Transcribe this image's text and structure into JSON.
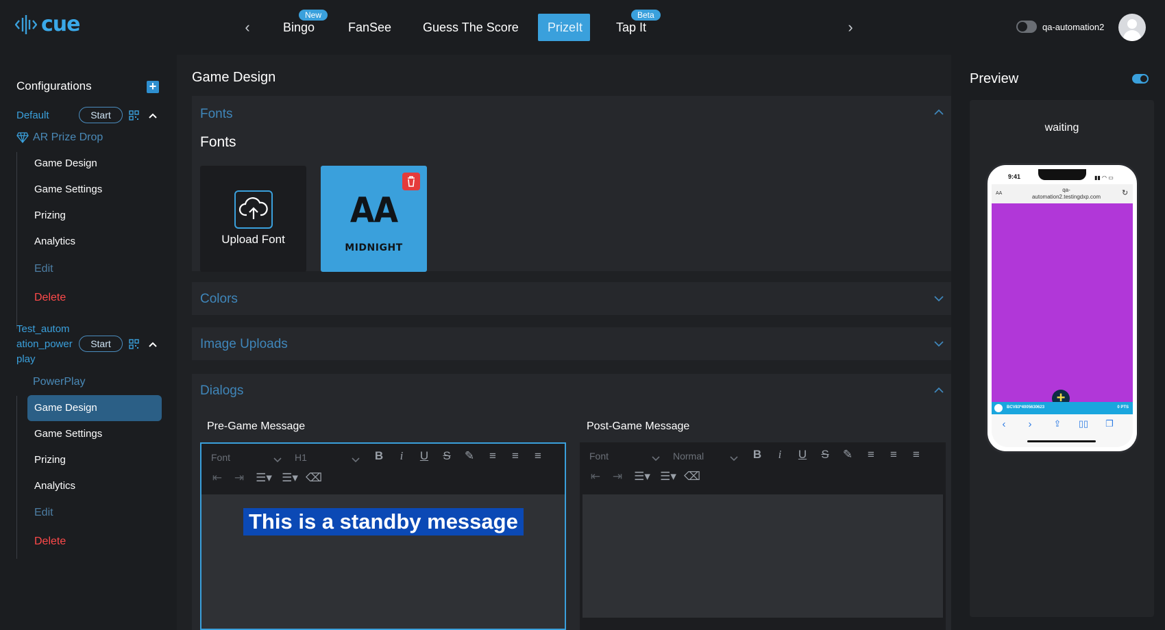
{
  "app": {
    "logo_text": "cue",
    "brand_color": "#3aa0dc"
  },
  "topnav": {
    "tabs": [
      {
        "label": "Bingo",
        "badge": "New"
      },
      {
        "label": "FanSee"
      },
      {
        "label": "Guess The Score"
      },
      {
        "label": "PrizeIt",
        "active": true
      },
      {
        "label": "Tap It",
        "badge": "Beta"
      }
    ],
    "user_name": "qa-automation2"
  },
  "sidebar": {
    "title": "Configurations",
    "configs": [
      {
        "name": "Default",
        "start_label": "Start",
        "game": "AR Prize Drop",
        "items": [
          "Game Design",
          "Game Settings",
          "Prizing",
          "Analytics"
        ],
        "edit_label": "Edit",
        "delete_label": "Delete"
      },
      {
        "name_lines": [
          "Test_autom",
          "ation_power",
          "play"
        ],
        "start_label": "Start",
        "game": "PowerPlay",
        "items": [
          "Game Design",
          "Game Settings",
          "Prizing",
          "Analytics"
        ],
        "active_item": "Game Design",
        "edit_label": "Edit",
        "delete_label": "Delete"
      }
    ]
  },
  "main": {
    "title": "Game Design",
    "sections": {
      "fonts": "Fonts",
      "colors": "Colors",
      "image_uploads": "Image Uploads",
      "dialogs": "Dialogs"
    },
    "fonts_subtitle": "Fonts",
    "upload_font_label": "Upload Font",
    "font_card": {
      "preview": "AA",
      "name": "MIDNIGHT"
    },
    "pre_game": {
      "title": "Pre-Game Message",
      "font_placeholder": "Font",
      "heading_value": "H1",
      "content": "This is a standby message"
    },
    "post_game": {
      "title": "Post-Game Message",
      "font_placeholder": "Font",
      "heading_value": "Normal"
    }
  },
  "preview": {
    "title": "Preview",
    "status": "waiting",
    "phone": {
      "time": "9:41",
      "url_aa": "AA",
      "url_lines": [
        "qa-",
        "automation2.testingdxp.com"
      ],
      "bar_left": "BCV83*4005630623",
      "bar_right": "0 PTS",
      "game_color": "#b137d8"
    }
  }
}
